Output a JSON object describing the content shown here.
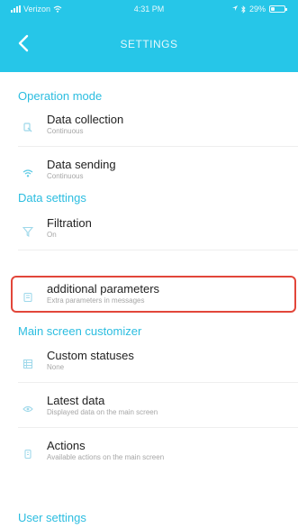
{
  "status_bar": {
    "carrier": "Verizon",
    "time": "4:31 PM",
    "battery_percent": "29%",
    "battery_level": 0.29
  },
  "nav": {
    "title": "SETTINGS",
    "back_icon": "chevron-left-icon"
  },
  "sections": [
    {
      "title": "Operation mode",
      "items": [
        {
          "title": "Data collection",
          "subtitle": "Continuous",
          "icon": "collection-icon"
        },
        {
          "title": "Data sending",
          "subtitle": "Continuous",
          "icon": "wifi-icon"
        }
      ]
    },
    {
      "title": "Data settings",
      "items": [
        {
          "title": "Filtration",
          "subtitle": "On",
          "icon": "filter-icon"
        },
        {
          "title": "additional parameters",
          "subtitle": "Extra parameters in messages",
          "icon": "parameters-icon",
          "highlighted": true
        }
      ]
    },
    {
      "title": "Main screen customizer",
      "items": [
        {
          "title": "Custom statuses",
          "subtitle": "None",
          "icon": "statuses-icon"
        },
        {
          "title": "Latest data",
          "subtitle": "Displayed data on the main screen",
          "icon": "eye-icon"
        },
        {
          "title": "Actions",
          "subtitle": "Available actions on the main screen",
          "icon": "actions-icon"
        }
      ]
    },
    {
      "title": "User settings",
      "items": []
    }
  ],
  "colors": {
    "header": "#26c6e8",
    "accent": "#2bbde0",
    "highlight_border": "#e2463a"
  }
}
